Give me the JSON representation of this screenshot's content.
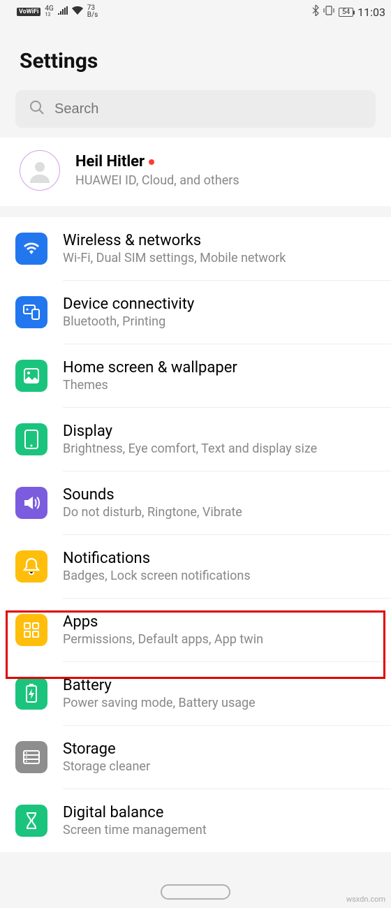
{
  "status": {
    "vowifi": "VoWiFi",
    "net": "4G",
    "netSub": "13",
    "speed_top": "73",
    "speed_bot": "B/s",
    "battery": "54",
    "time": "11:03"
  },
  "header": {
    "title": "Settings"
  },
  "search": {
    "placeholder": "Search"
  },
  "account": {
    "name": "Heil Hitler",
    "subtitle": "HUAWEI ID, Cloud, and others"
  },
  "items": [
    {
      "icon": "wifi-icon",
      "color": "ic-blue",
      "title": "Wireless & networks",
      "subtitle": "Wi-Fi, Dual SIM settings, Mobile network"
    },
    {
      "icon": "device-connectivity-icon",
      "color": "ic-blue",
      "title": "Device connectivity",
      "subtitle": "Bluetooth, Printing"
    },
    {
      "icon": "home-wallpaper-icon",
      "color": "ic-green",
      "title": "Home screen & wallpaper",
      "subtitle": "Themes"
    },
    {
      "icon": "display-icon",
      "color": "ic-green",
      "title": "Display",
      "subtitle": "Brightness, Eye comfort, Text and display size"
    },
    {
      "icon": "sounds-icon",
      "color": "ic-purple",
      "title": "Sounds",
      "subtitle": "Do not disturb, Ringtone, Vibrate"
    },
    {
      "icon": "notifications-icon",
      "color": "ic-yellow",
      "title": "Notifications",
      "subtitle": "Badges, Lock screen notifications"
    },
    {
      "icon": "apps-icon",
      "color": "ic-yellow",
      "title": "Apps",
      "subtitle": "Permissions, Default apps, App twin"
    },
    {
      "icon": "battery-icon",
      "color": "ic-green",
      "title": "Battery",
      "subtitle": "Power saving mode, Battery usage"
    },
    {
      "icon": "storage-icon",
      "color": "ic-gray",
      "title": "Storage",
      "subtitle": "Storage cleaner"
    },
    {
      "icon": "digital-balance-icon",
      "color": "ic-green",
      "title": "Digital balance",
      "subtitle": "Screen time management"
    }
  ],
  "watermark": "wsxdn.com"
}
